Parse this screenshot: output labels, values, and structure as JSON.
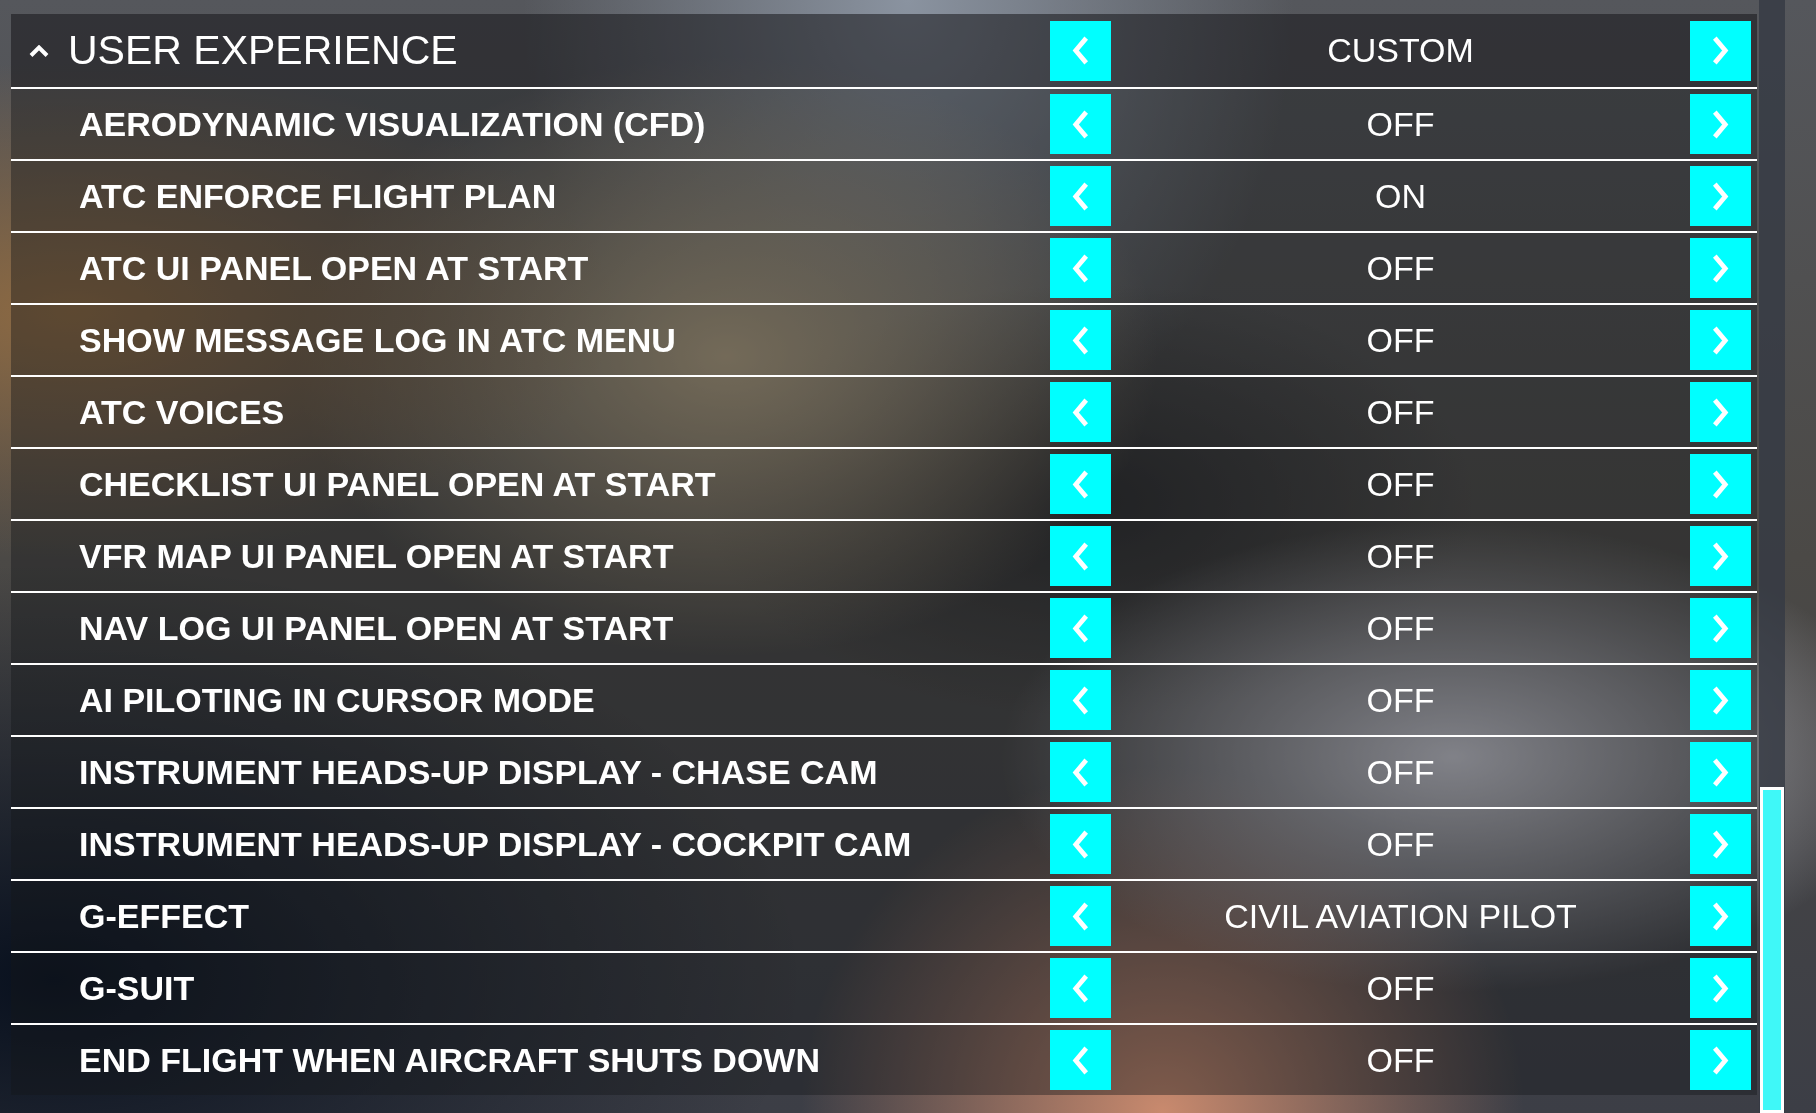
{
  "section": {
    "title": "USER EXPERIENCE",
    "expanded": true,
    "value": "CUSTOM"
  },
  "settings": [
    {
      "label": "AERODYNAMIC VISUALIZATION (CFD)",
      "value": "OFF"
    },
    {
      "label": "ATC ENFORCE FLIGHT PLAN",
      "value": "ON"
    },
    {
      "label": "ATC UI PANEL OPEN AT START",
      "value": "OFF"
    },
    {
      "label": "SHOW MESSAGE LOG IN ATC MENU",
      "value": "OFF"
    },
    {
      "label": "ATC VOICES",
      "value": "OFF"
    },
    {
      "label": "CHECKLIST UI PANEL OPEN AT START",
      "value": "OFF"
    },
    {
      "label": "VFR MAP UI PANEL OPEN AT START",
      "value": "OFF"
    },
    {
      "label": "NAV LOG UI PANEL OPEN AT START",
      "value": "OFF"
    },
    {
      "label": "AI PILOTING IN CURSOR MODE",
      "value": "OFF"
    },
    {
      "label": "INSTRUMENT HEADS-UP DISPLAY - CHASE CAM",
      "value": "OFF"
    },
    {
      "label": "INSTRUMENT HEADS-UP DISPLAY - COCKPIT CAM",
      "value": "OFF"
    },
    {
      "label": "G-EFFECT",
      "value": "CIVIL AVIATION PILOT"
    },
    {
      "label": "G-SUIT",
      "value": "OFF"
    },
    {
      "label": "END FLIGHT WHEN AIRCRAFT SHUTS DOWN",
      "value": "OFF"
    }
  ]
}
